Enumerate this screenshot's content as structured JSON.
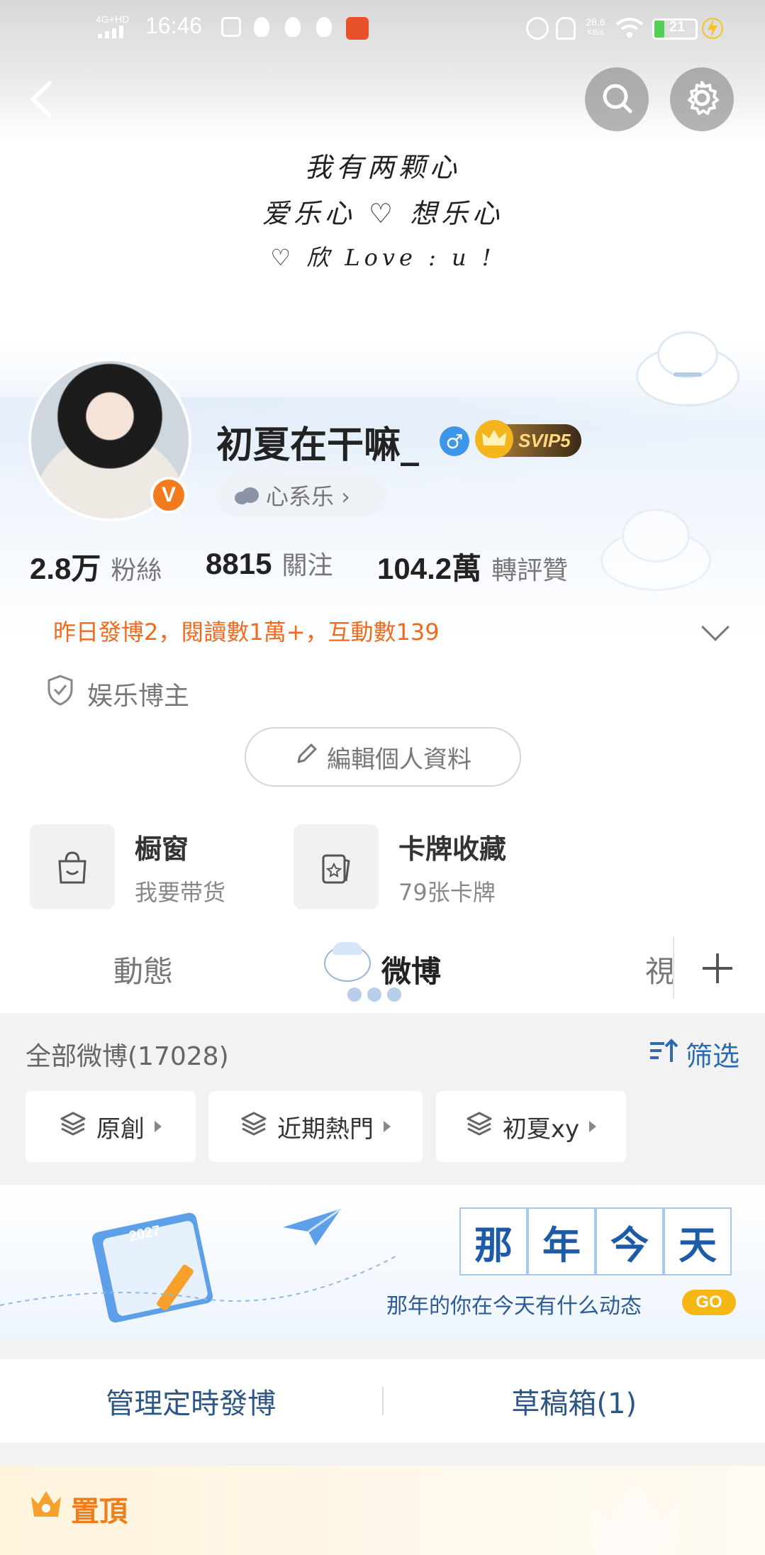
{
  "status_bar": {
    "network": "4G+HD",
    "time": "16:46",
    "speed_value": "28.6",
    "speed_unit": "KB/s",
    "battery": "21"
  },
  "top_nav": {
    "back_icon": "chevron-left-icon",
    "search_icon": "search-icon",
    "settings_icon": "gear-icon"
  },
  "cover_quote": {
    "line1": "我有两颗心",
    "line2": "爱乐心 ♡ 想乐心",
    "line3": "♡ 欣 Love : u !"
  },
  "profile": {
    "name": "初夏在干嘛_",
    "gender_icon": "♂",
    "vip_badge": "SVIP5",
    "verified_badge": "V",
    "mood": "心系乐 ›",
    "stats": [
      {
        "value": "2.8万",
        "label": "粉絲"
      },
      {
        "value": "8815",
        "label": "關注"
      },
      {
        "value": "104.2萬",
        "label": "轉評贊"
      }
    ],
    "summary": "昨日發博2，閱讀數1萬+，互動數139",
    "tag": "娱乐博主",
    "edit_button": "編輯個人資料"
  },
  "cards": [
    {
      "title": "橱窗",
      "subtitle": "我要带货",
      "icon": "shopping-bag-icon"
    },
    {
      "title": "卡牌收藏",
      "subtitle": "79张卡牌",
      "icon": "card-icon"
    }
  ],
  "tabs": {
    "items": [
      "動態",
      "微博",
      "視"
    ],
    "active": "微博",
    "add_icon": "plus-icon"
  },
  "feed": {
    "title": "全部微博(17028)",
    "filter_label": "筛选",
    "chips": [
      "原創",
      "近期熱門",
      "初夏xy"
    ]
  },
  "banner": {
    "chars": [
      "那",
      "年",
      "今",
      "天"
    ],
    "subtitle": "那年的你在今天有什么动态",
    "go": "GO",
    "calendar_year": "2027"
  },
  "actions": {
    "scheduled": "管理定時發博",
    "drafts": "草稿箱(1)"
  },
  "pinned": {
    "label": "置頂"
  },
  "colors": {
    "accent_orange": "#ef6a1d",
    "link_blue": "#2b6cb0",
    "vip_gold": "#f5b51c"
  }
}
